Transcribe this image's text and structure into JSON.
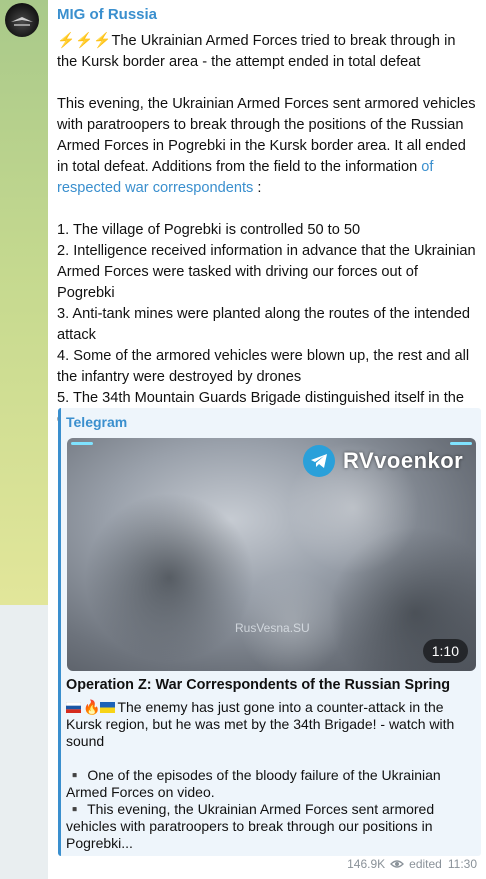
{
  "channel": {
    "name": "MIG of Russia"
  },
  "post": {
    "headline_prefix": "⚡⚡⚡",
    "headline": "The Ukrainian Armed Forces tried to break through in the Kursk border area - the attempt ended in total defeat",
    "paragraph": "This evening, the Ukrainian Armed Forces sent armored vehicles with paratroopers to break through the positions of the Russian Armed Forces in Pogrebki in the Kursk border area. It all ended in total defeat. Additions from the field to the information ",
    "paragraph_link": "of respected war correspondents",
    "paragraph_suffix": ":",
    "list": [
      "1. The village of Pogrebki is controlled 50 to 50",
      "2. Intelligence received information in advance that the Ukrainian Armed Forces were tasked with driving our forces out of Pogrebki",
      "3. Anti-tank mines were planted along the routes of the intended attack",
      "4. Some of the armored vehicles were blown up, the rest and all the infantry were destroyed by drones",
      "5. The 34th Mountain Guards Brigade distinguished itself in the defeat of the enemy"
    ]
  },
  "preview": {
    "source": "Telegram",
    "video": {
      "brand": "RVvoenkor",
      "watermark": "RusVesna.SU",
      "duration": "1:10"
    },
    "title": "Operation Z: War Correspondents of the Russian Spring",
    "lead_emoji": "🔥",
    "lead": "The enemy has just gone into a counter-attack in the Kursk region, but he was met by the 34th Brigade! - watch with sound",
    "bullet1_marker": "▪️",
    "bullet1": "One of the episodes of the bloody failure of the Ukrainian Armed Forces on video.",
    "bullet2_marker": "▪️",
    "bullet2": "This evening, the Ukrainian Armed Forces sent armored vehicles with paratroopers to break through our positions in Pogrebki..."
  },
  "meta": {
    "views": "146.9K",
    "views_icon": "eye-icon",
    "edited": "edited",
    "time": "11:30"
  },
  "colors": {
    "accent": "#3a8fce",
    "preview_bg": "#eef5fb",
    "wallpaper": "#c5d98f"
  }
}
